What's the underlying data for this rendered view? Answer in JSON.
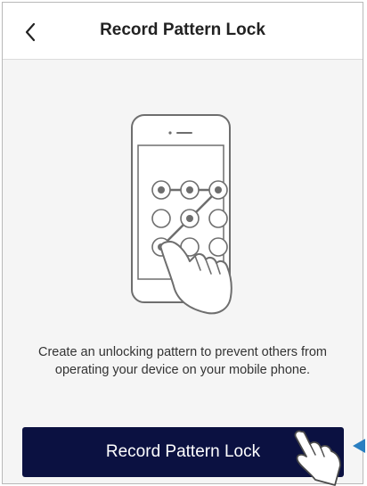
{
  "header": {
    "title": "Record Pattern Lock",
    "back_icon": "chevron-left-icon"
  },
  "illustration": {
    "icon": "phone-pattern-lock-illustration",
    "pattern_grid": "3x3",
    "selected_dots": [
      1,
      2,
      3,
      5,
      7
    ]
  },
  "description": "Create an unlocking pattern to prevent others from operating your device on your mobile phone.",
  "cta": {
    "label": "Record Pattern Lock"
  },
  "colors": {
    "button_bg": "#0b1141",
    "accent_arrow": "#2a7fc1"
  }
}
